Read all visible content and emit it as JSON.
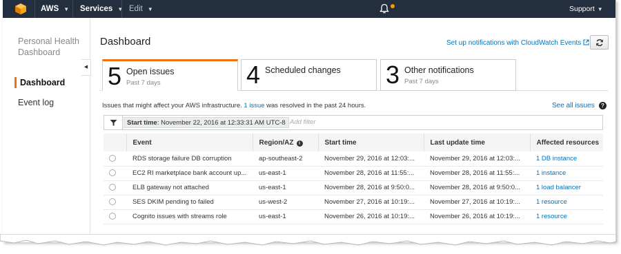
{
  "navbar": {
    "account_label": "AWS",
    "services_label": "Services",
    "edit_label": "Edit",
    "support_label": "Support"
  },
  "sidebar": {
    "title": "Personal Health Dashboard",
    "items": [
      {
        "label": "Dashboard",
        "active": true
      },
      {
        "label": "Event log",
        "active": false
      }
    ]
  },
  "main": {
    "title": "Dashboard",
    "cloudwatch_link": "Set up notifications with CloudWatch Events",
    "tabs": [
      {
        "count": "5",
        "label": "Open issues",
        "sub": "Past 7 days",
        "active": true
      },
      {
        "count": "4",
        "label": "Scheduled changes",
        "sub": "",
        "active": false
      },
      {
        "count": "3",
        "label": "Other notifications",
        "sub": "Past 7 days",
        "active": false
      }
    ],
    "info_prefix": "Issues that might affect your AWS infrastructure.",
    "info_link": "1 issue",
    "info_suffix": "was resolved in the past 24 hours.",
    "see_all": "See all issues",
    "filter": {
      "token_key": "Start time",
      "token_value": ": November 22, 2016 at 12:33:31 AM UTC-8",
      "placeholder": "Add filter"
    },
    "table": {
      "headers": [
        "Event",
        "Region/AZ",
        "Start time",
        "Last update time",
        "Affected resources"
      ],
      "rows": [
        {
          "event": "RDS storage failure DB corruption",
          "region": "ap-southeast-2",
          "start": "November 29, 2016 at 12:03:...",
          "updated": "November 29, 2016 at 12:03:...",
          "resources": "1 DB instance"
        },
        {
          "event": "EC2 RI marketplace bank account up...",
          "region": "us-east-1",
          "start": "November 28, 2016 at 11:55:...",
          "updated": "November 28, 2016 at 11:55:...",
          "resources": "1 instance"
        },
        {
          "event": "ELB gateway not attached",
          "region": "us-east-1",
          "start": "November 28, 2016 at 9:50:0...",
          "updated": "November 28, 2016 at 9:50:0...",
          "resources": "1 load balancer"
        },
        {
          "event": "SES DKIM pending to failed",
          "region": "us-west-2",
          "start": "November 27, 2016 at 10:19:...",
          "updated": "November 27, 2016 at 10:19:...",
          "resources": "1 resource"
        },
        {
          "event": "Cognito issues with streams role",
          "region": "us-east-1",
          "start": "November 26, 2016 at 10:19:...",
          "updated": "November 26, 2016 at 10:19:...",
          "resources": "1 resource"
        }
      ]
    }
  },
  "colors": {
    "navbar_bg": "#232f3e",
    "accent_orange": "#ec7211",
    "link_blue": "#0073bb"
  },
  "icons": [
    "aws-logo-icon",
    "caret-down-icon",
    "bell-icon",
    "notification-dot-icon",
    "collapse-arrow-icon",
    "external-link-icon",
    "refresh-icon",
    "help-icon",
    "filter-icon",
    "info-icon",
    "radio-icon"
  ]
}
